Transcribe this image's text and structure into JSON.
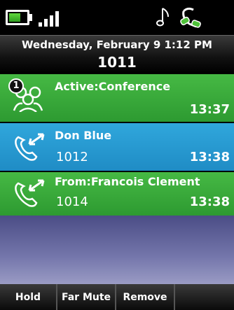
{
  "status": {
    "battery_icon": "battery-icon",
    "signal_icon": "signal-bars-icon",
    "music_icon": "music-note-icon",
    "headset_icon": "headset-icon"
  },
  "header": {
    "datetime": "Wednesday, February 9 1:12 PM",
    "extension": "1011"
  },
  "calls": [
    {
      "icon": "conference-icon",
      "badge": "1",
      "title": "Active:Conference",
      "number": "",
      "time": "13:37",
      "color": "#3cad3b"
    },
    {
      "icon": "phone-transfer-icon",
      "title": "Don Blue",
      "number": "1012",
      "time": "13:38",
      "color": "#2899d2"
    },
    {
      "icon": "phone-transfer-icon",
      "title": "From:Francois Clement",
      "number": "1014",
      "time": "13:38",
      "color": "#3cad3b"
    }
  ],
  "softkeys": [
    "Hold",
    "Far Mute",
    "Remove",
    ""
  ]
}
